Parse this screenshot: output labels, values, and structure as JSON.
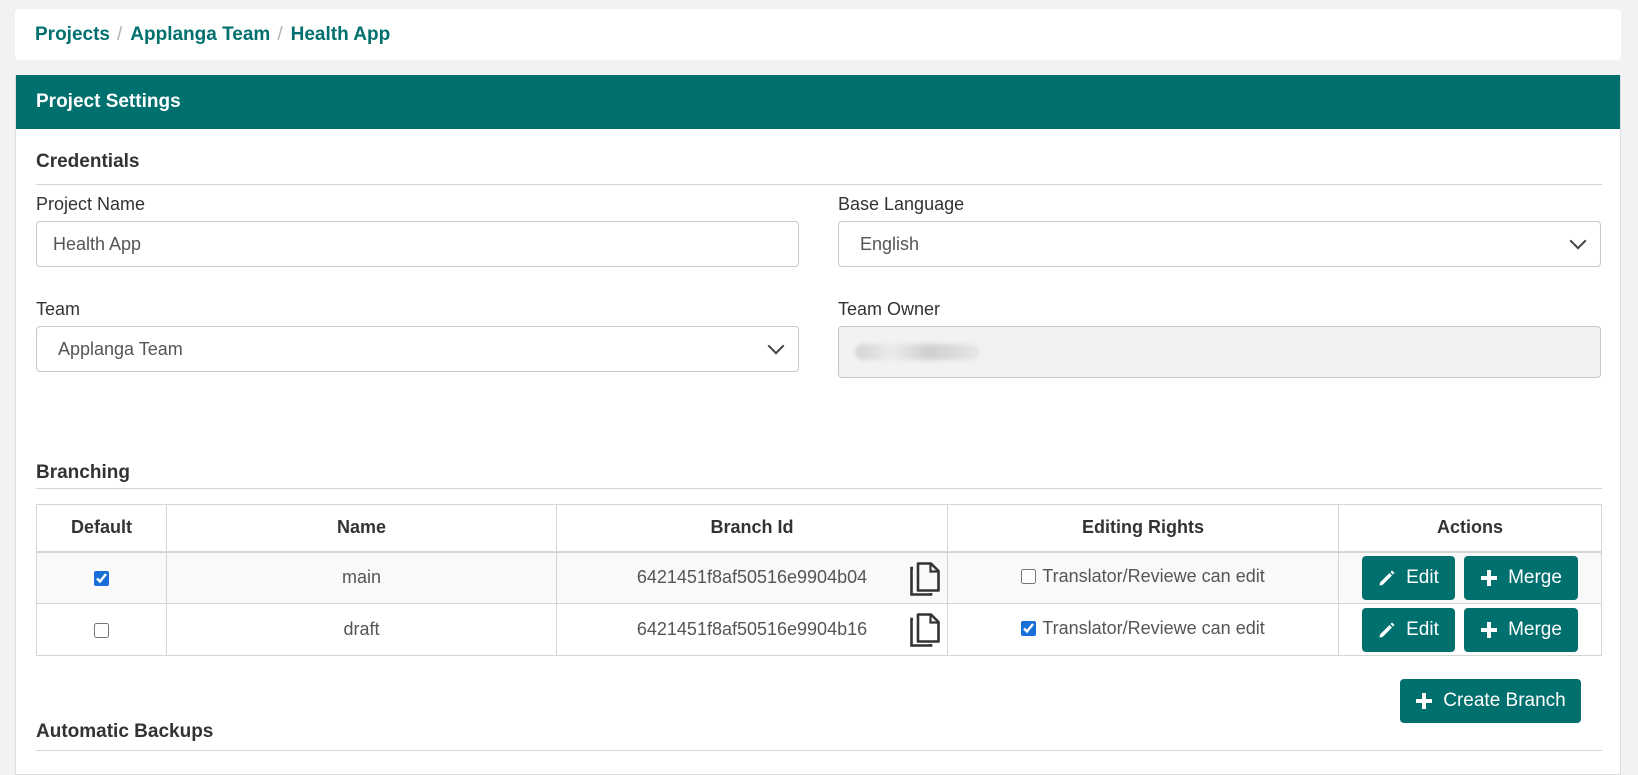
{
  "breadcrumb": [
    {
      "label": "Projects"
    },
    {
      "label": "Applanga Team"
    },
    {
      "label": "Health App"
    }
  ],
  "breadcrumb_separator": "/",
  "panel": {
    "title": "Project Settings"
  },
  "credentials": {
    "title": "Credentials",
    "project_name_label": "Project Name",
    "project_name_value": "Health App",
    "base_language_label": "Base Language",
    "base_language_value": "English",
    "team_label": "Team",
    "team_value": "Applanga Team",
    "team_owner_label": "Team Owner"
  },
  "branching": {
    "title": "Branching",
    "columns": [
      "Default",
      "Name",
      "Branch Id",
      "Editing Rights",
      "Actions"
    ],
    "rows": [
      {
        "default": true,
        "name": "main",
        "branch_id": "6421451f8af50516e9904b04",
        "editing_allowed": false,
        "editing_label": "Translator/Reviewe can edit"
      },
      {
        "default": false,
        "name": "draft",
        "branch_id": "6421451f8af50516e9904b16",
        "editing_allowed": true,
        "editing_label": "Translator/Reviewe can edit"
      }
    ],
    "edit_label": "Edit",
    "merge_label": "Merge",
    "create_label": "Create Branch"
  },
  "backups": {
    "title": "Automatic Backups"
  },
  "colors": {
    "accent": "#00706e",
    "link": "#00706e",
    "checkbox": "#1a6ed8"
  },
  "icons": {
    "copy": "copy-icon",
    "edit": "pencil-icon",
    "add": "plus-icon",
    "dropdown": "chevron-down-icon"
  }
}
